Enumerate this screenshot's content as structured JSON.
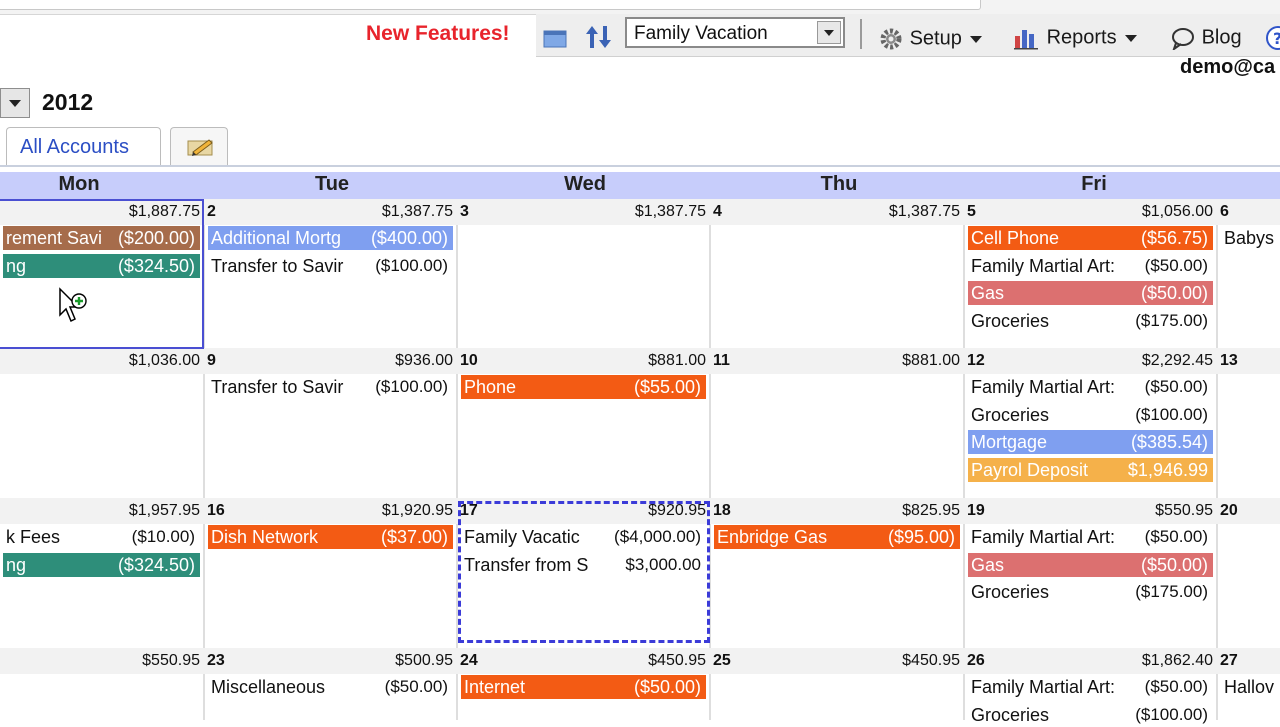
{
  "header": {
    "new_features": "New Features!",
    "budget_select": "Family Vacation",
    "menus": [
      {
        "label": "Setup",
        "icon": "gear-icon"
      },
      {
        "label": "Reports",
        "icon": "bar-chart-icon"
      },
      {
        "label": "Blog",
        "icon": "speech-bubble-icon"
      }
    ],
    "user": "demo@ca"
  },
  "year": "2012",
  "tabs": {
    "all_accounts": "All Accounts"
  },
  "days": [
    "Mon",
    "Tue",
    "Wed",
    "Thu",
    "Fri"
  ],
  "colors": {
    "brown": "#a66c4b",
    "teal": "#2e8e7a",
    "blue": "#7f9ff0",
    "orange": "#f35b14",
    "rose": "#dc7070",
    "amber": "#f5b14a"
  },
  "weeks": [
    {
      "cells": [
        {
          "num": "",
          "bal": "$1,887.75",
          "items": [
            {
              "d": "rement Savi",
              "a": "($200.00)",
              "c": "brown"
            },
            {
              "d": "ng",
              "a": "($324.50)",
              "c": "teal"
            }
          ]
        },
        {
          "num": "2",
          "bal": "$1,387.75",
          "items": [
            {
              "d": "Additional Mortg",
              "a": "($400.00)",
              "c": "blue"
            },
            {
              "d": "Transfer to Savir",
              "a": "($100.00)",
              "c": ""
            }
          ]
        },
        {
          "num": "3",
          "bal": "$1,387.75",
          "items": []
        },
        {
          "num": "4",
          "bal": "$1,387.75",
          "items": []
        },
        {
          "num": "5",
          "bal": "$1,056.00",
          "items": [
            {
              "d": "Cell Phone",
              "a": "($56.75)",
              "c": "orange"
            },
            {
              "d": "Family Martial Art:",
              "a": "($50.00)",
              "c": ""
            },
            {
              "d": "Gas",
              "a": "($50.00)",
              "c": "rose"
            },
            {
              "d": "Groceries",
              "a": "($175.00)",
              "c": ""
            }
          ]
        },
        {
          "num": "6",
          "bal": "",
          "items": [
            {
              "d": "Babys",
              "a": "",
              "c": ""
            }
          ]
        }
      ]
    },
    {
      "cells": [
        {
          "num": "",
          "bal": "$1,036.00",
          "items": []
        },
        {
          "num": "9",
          "bal": "$936.00",
          "items": [
            {
              "d": "Transfer to Savir",
              "a": "($100.00)",
              "c": ""
            }
          ]
        },
        {
          "num": "10",
          "bal": "$881.00",
          "items": [
            {
              "d": "Phone",
              "a": "($55.00)",
              "c": "orange"
            }
          ]
        },
        {
          "num": "11",
          "bal": "$881.00",
          "items": []
        },
        {
          "num": "12",
          "bal": "$2,292.45",
          "items": [
            {
              "d": "Family Martial Art:",
              "a": "($50.00)",
              "c": ""
            },
            {
              "d": "Groceries",
              "a": "($100.00)",
              "c": ""
            },
            {
              "d": "Mortgage",
              "a": "($385.54)",
              "c": "blue"
            },
            {
              "d": "Payrol Deposit",
              "a": "$1,946.99",
              "c": "amber"
            }
          ]
        },
        {
          "num": "13",
          "bal": "",
          "items": []
        }
      ]
    },
    {
      "cells": [
        {
          "num": "",
          "bal": "$1,957.95",
          "items": [
            {
              "d": "k Fees",
              "a": "($10.00)",
              "c": ""
            },
            {
              "d": "ng",
              "a": "($324.50)",
              "c": "teal"
            }
          ]
        },
        {
          "num": "16",
          "bal": "$1,920.95",
          "items": [
            {
              "d": "Dish Network",
              "a": "($37.00)",
              "c": "orange"
            }
          ]
        },
        {
          "num": "17",
          "bal": "$920.95",
          "items": [
            {
              "d": "Family Vacatic",
              "a": "($4,000.00)",
              "c": ""
            },
            {
              "d": "Transfer from S",
              "a": "$3,000.00",
              "c": ""
            }
          ]
        },
        {
          "num": "18",
          "bal": "$825.95",
          "items": [
            {
              "d": "Enbridge Gas",
              "a": "($95.00)",
              "c": "orange"
            }
          ]
        },
        {
          "num": "19",
          "bal": "$550.95",
          "items": [
            {
              "d": "Family Martial Art:",
              "a": "($50.00)",
              "c": ""
            },
            {
              "d": "Gas",
              "a": "($50.00)",
              "c": "rose"
            },
            {
              "d": "Groceries",
              "a": "($175.00)",
              "c": ""
            }
          ]
        },
        {
          "num": "20",
          "bal": "",
          "items": []
        }
      ]
    },
    {
      "cells": [
        {
          "num": "",
          "bal": "$550.95",
          "items": []
        },
        {
          "num": "23",
          "bal": "$500.95",
          "items": [
            {
              "d": "Miscellaneous",
              "a": "($50.00)",
              "c": ""
            }
          ]
        },
        {
          "num": "24",
          "bal": "$450.95",
          "items": [
            {
              "d": "Internet",
              "a": "($50.00)",
              "c": "orange"
            }
          ]
        },
        {
          "num": "25",
          "bal": "$450.95",
          "items": []
        },
        {
          "num": "26",
          "bal": "$1,862.40",
          "items": [
            {
              "d": "Family Martial Art:",
              "a": "($50.00)",
              "c": ""
            },
            {
              "d": "Groceries",
              "a": "($100.00)",
              "c": ""
            }
          ]
        },
        {
          "num": "27",
          "bal": "",
          "items": [
            {
              "d": "Hallov",
              "a": "",
              "c": ""
            }
          ]
        }
      ]
    }
  ]
}
